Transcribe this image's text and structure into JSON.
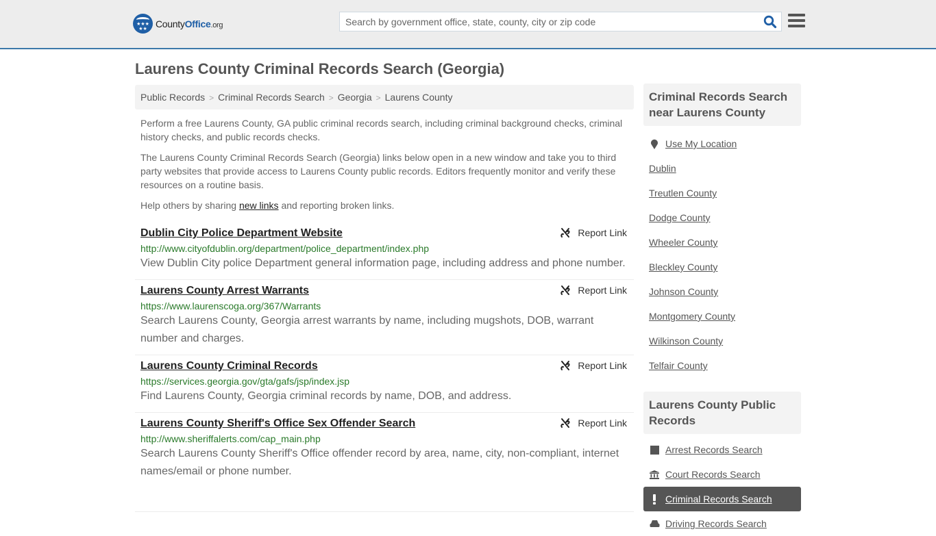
{
  "header": {
    "logo": {
      "name_a": "County",
      "name_b": "Office",
      "name_c": ".org",
      "stars": "★★★\n★★"
    },
    "search": {
      "placeholder": "Search by government office, state, county, city or zip code",
      "value": ""
    },
    "colors": {
      "brand": "#1f5fa6",
      "accent_bar": "#3c79aa"
    }
  },
  "page": {
    "title": "Laurens County Criminal Records Search (Georgia)"
  },
  "breadcrumb": [
    {
      "label": "Public Records"
    },
    {
      "label": "Criminal Records Search"
    },
    {
      "label": "Georgia"
    },
    {
      "label": "Laurens County"
    }
  ],
  "breadcrumb_separator": ">",
  "intro": {
    "p1": "Perform a free Laurens County, GA public criminal records search, including criminal background checks, criminal history checks, and public records checks.",
    "p2": "The Laurens County Criminal Records Search (Georgia) links below open in a new window and take you to third party websites that provide access to Laurens County public records. Editors frequently monitor and verify these resources on a routine basis.",
    "p3_before": "Help others by sharing ",
    "p3_link": "new links",
    "p3_after": " and reporting broken links."
  },
  "results": [
    {
      "title": "Dublin City Police Department Website",
      "url": "http://www.cityofdublin.org/department/police_department/index.php",
      "description": "View Dublin City police Department general information page, including address and phone number.",
      "report_label": "Report Link"
    },
    {
      "title": "Laurens County Arrest Warrants",
      "url": "https://www.laurenscoga.org/367/Warrants",
      "description": "Search Laurens County, Georgia arrest warrants by name, including mugshots, DOB, warrant number and charges.",
      "report_label": "Report Link"
    },
    {
      "title": "Laurens County Criminal Records",
      "url": "https://services.georgia.gov/gta/gafs/jsp/index.jsp",
      "description": "Find Laurens County, Georgia criminal records by name, DOB, and address.",
      "report_label": "Report Link"
    },
    {
      "title": "Laurens County Sheriff's Office Sex Offender Search",
      "url": "http://www.sheriffalerts.com/cap_main.php",
      "description": "Search Laurens County Sheriff's Office offender record by area, name, city, non-compliant, internet names/email or phone number.",
      "report_label": "Report Link"
    }
  ],
  "sidebar": {
    "nearby": {
      "heading": "Criminal Records Search near Laurens County",
      "use_location": "Use My Location",
      "items": [
        "Dublin",
        "Treutlen County",
        "Dodge County",
        "Wheeler County",
        "Bleckley County",
        "Johnson County",
        "Montgomery County",
        "Wilkinson County",
        "Telfair County"
      ]
    },
    "public_records": {
      "heading": "Laurens County Public Records",
      "items": [
        {
          "label": "Arrest Records Search",
          "icon": "square-icon",
          "active": false
        },
        {
          "label": "Court Records Search",
          "icon": "courthouse-icon",
          "active": false
        },
        {
          "label": "Criminal Records Search",
          "icon": "exclamation-icon",
          "active": true
        },
        {
          "label": "Driving Records Search",
          "icon": "car-icon",
          "active": false
        }
      ]
    }
  }
}
